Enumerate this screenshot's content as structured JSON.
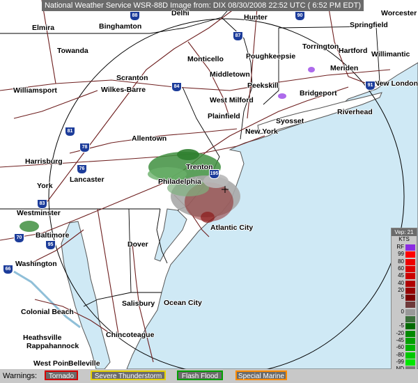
{
  "title": "National Weather Service WSR-88D Image from: DIX 08/30/2008 22:52 UTC ( 6:52 PM EDT)",
  "colors": {
    "ocean": "#cfe9f5",
    "land": "#ffffff",
    "roads": "#6e1f1f",
    "borders": "#000000",
    "range_ring": "#000000",
    "precip_green": "#3f8f3f",
    "precip_gray": "#a9a9a9",
    "precip_darkred": "#8b1a1a"
  },
  "cities": [
    {
      "id": "delhi",
      "name": "Delhi"
    },
    {
      "id": "hunter",
      "name": "Hunter"
    },
    {
      "id": "worcester",
      "name": "Worcester"
    },
    {
      "id": "elmira",
      "name": "Elmira"
    },
    {
      "id": "binghamton",
      "name": "Binghamton"
    },
    {
      "id": "springfield",
      "name": "Springfield"
    },
    {
      "id": "towanda",
      "name": "Towanda"
    },
    {
      "id": "monticello",
      "name": "Monticello"
    },
    {
      "id": "poughkeepsie",
      "name": "Poughkeepsie"
    },
    {
      "id": "torrington",
      "name": "Torrington"
    },
    {
      "id": "hartford",
      "name": "Hartford"
    },
    {
      "id": "willimantic",
      "name": "Willimantic"
    },
    {
      "id": "middletown",
      "name": "Middletown"
    },
    {
      "id": "meriden",
      "name": "Meriden"
    },
    {
      "id": "scranton",
      "name": "Scranton"
    },
    {
      "id": "peekskill",
      "name": "Peekskill"
    },
    {
      "id": "new-london",
      "name": "New London"
    },
    {
      "id": "williamsport",
      "name": "Williamsport"
    },
    {
      "id": "wilkes-barre",
      "name": "Wilkes-Barre"
    },
    {
      "id": "bridgeport",
      "name": "Bridgeport"
    },
    {
      "id": "west-milford",
      "name": "West Milford"
    },
    {
      "id": "riverhead",
      "name": "Riverhead"
    },
    {
      "id": "syosset",
      "name": "Syosset"
    },
    {
      "id": "plainfield",
      "name": "Plainfield"
    },
    {
      "id": "new-york",
      "name": "New York"
    },
    {
      "id": "allentown",
      "name": "Allentown"
    },
    {
      "id": "harrisburg",
      "name": "Harrisburg"
    },
    {
      "id": "trenton",
      "name": "Trenton"
    },
    {
      "id": "lancaster",
      "name": "Lancaster"
    },
    {
      "id": "philadelphia",
      "name": "Philadelphia"
    },
    {
      "id": "york",
      "name": "York"
    },
    {
      "id": "westminster",
      "name": "Westminster"
    },
    {
      "id": "atlantic-city",
      "name": "Atlantic City"
    },
    {
      "id": "baltimore",
      "name": "Baltimore"
    },
    {
      "id": "dover",
      "name": "Dover"
    },
    {
      "id": "washington",
      "name": "Washington"
    },
    {
      "id": "salisbury",
      "name": "Salisbury"
    },
    {
      "id": "ocean-city",
      "name": "Ocean City"
    },
    {
      "id": "colonial-beach",
      "name": "Colonial Beach"
    },
    {
      "id": "chincoteague",
      "name": "Chincoteague"
    },
    {
      "id": "heathsville",
      "name": "Heathsville"
    },
    {
      "id": "rappahannock",
      "name": "Rappahannock"
    },
    {
      "id": "west-point",
      "name": "West Point"
    },
    {
      "id": "belleville",
      "name": "Belleville"
    }
  ],
  "highway_shields": [
    "88",
    "90",
    "87",
    "84",
    "91",
    "81",
    "78",
    "76",
    "195",
    "83",
    "95",
    "70",
    "66"
  ],
  "legend": {
    "product": "Vep: 21",
    "unit": "KTS",
    "entries": [
      {
        "label": "RF",
        "color": "#8a2be2"
      },
      {
        "label": "99",
        "color": "#ff0000"
      },
      {
        "label": "80",
        "color": "#ee0000"
      },
      {
        "label": "60",
        "color": "#dd0000"
      },
      {
        "label": "45",
        "color": "#cc0000"
      },
      {
        "label": "40",
        "color": "#b00000"
      },
      {
        "label": "20",
        "color": "#960000"
      },
      {
        "label": "5",
        "color": "#7a0000"
      },
      {
        "label": "",
        "color": "#6e3a3a"
      },
      {
        "label": "0",
        "color": "#999999"
      },
      {
        "label": "",
        "color": "#3a6e3a"
      },
      {
        "label": "-5",
        "color": "#006a00"
      },
      {
        "label": "-20",
        "color": "#008800"
      },
      {
        "label": "-45",
        "color": "#00a000"
      },
      {
        "label": "-60",
        "color": "#00b400"
      },
      {
        "label": "-80",
        "color": "#00c800"
      },
      {
        "label": "-99",
        "color": "#00e600"
      },
      {
        "label": "ND",
        "color": "#7c7c7c"
      }
    ]
  },
  "warnings": {
    "label": "Warnings:",
    "items": [
      {
        "id": "tornado",
        "label": "Tornado",
        "border": "#d40000"
      },
      {
        "id": "severe-thunderstorm",
        "label": "Severe Thunderstorm",
        "border": "#e6d200"
      },
      {
        "id": "flash-flood",
        "label": "Flash Flood",
        "border": "#00a000"
      },
      {
        "id": "special-marine",
        "label": "Special Marine",
        "border": "#ff8c00"
      }
    ]
  }
}
